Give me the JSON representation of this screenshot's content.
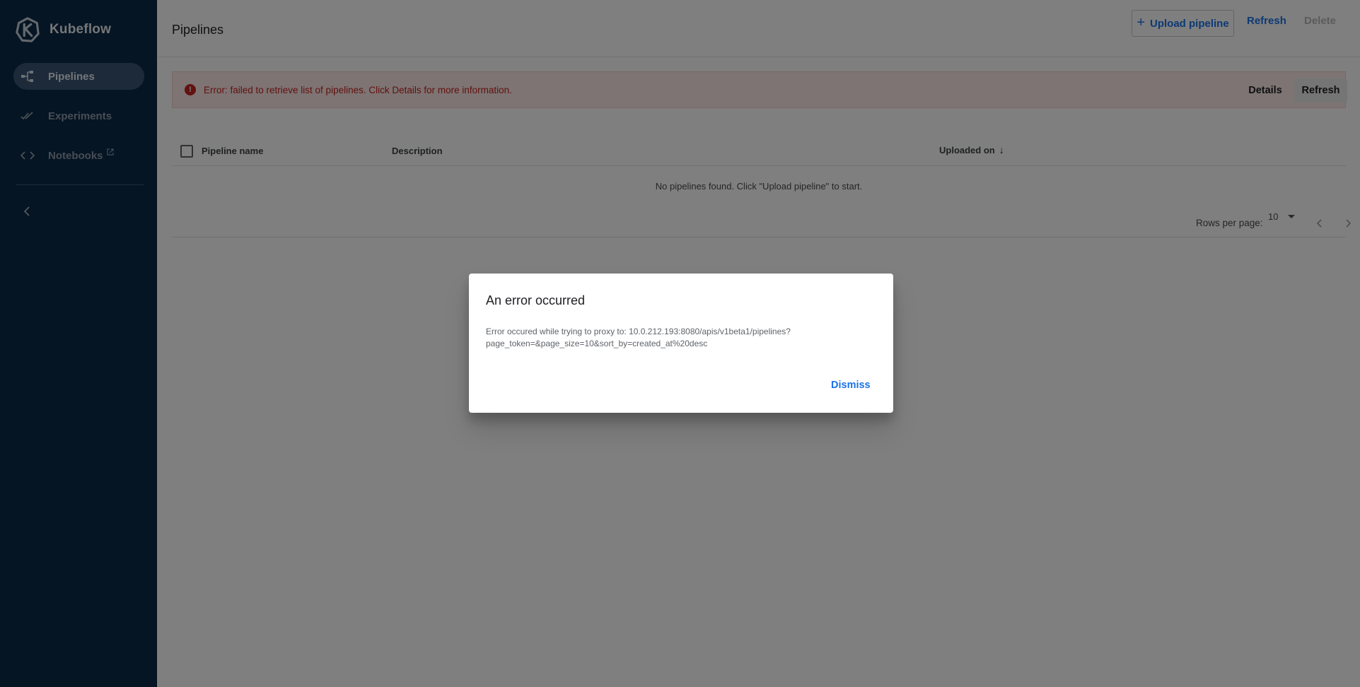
{
  "app": {
    "name": "Kubeflow",
    "logo_icon": "kubeflow-logo-icon"
  },
  "sidebar": {
    "items": [
      {
        "label": "Pipelines",
        "icon": "pipeline-icon",
        "active": true
      },
      {
        "label": "Experiments",
        "icon": "double-check-icon",
        "active": false
      },
      {
        "label": "Notebooks",
        "icon": "code-brackets-icon",
        "active": false,
        "external": true
      }
    ],
    "collapse_icon": "chevron-left-icon"
  },
  "header": {
    "title": "Pipelines",
    "upload_label": "Upload pipeline",
    "refresh_label": "Refresh",
    "delete_label": "Delete"
  },
  "banner": {
    "message": "Error: failed to retrieve list of pipelines. Click Details for more information.",
    "icon_glyph": "!",
    "details_label": "Details",
    "refresh_label": "Refresh"
  },
  "table": {
    "columns": [
      "Pipeline name",
      "Description",
      "Uploaded on"
    ],
    "sort_column": "Uploaded on",
    "empty_message": "No pipelines found. Click \"Upload pipeline\" to start.",
    "rows_per_page_label": "Rows per page:",
    "rows_per_page_value": "10"
  },
  "dialog": {
    "title": "An error occurred",
    "body": "Error occured while trying to proxy to: 10.0.212.193:8080/apis/v1beta1/pipelines?page_token=&page_size=10&sort_by=created_at%20desc",
    "dismiss_label": "Dismiss"
  },
  "colors": {
    "sidebar_bg": "#0c2a48",
    "accent": "#1a73e8",
    "error": "#c5221f"
  }
}
